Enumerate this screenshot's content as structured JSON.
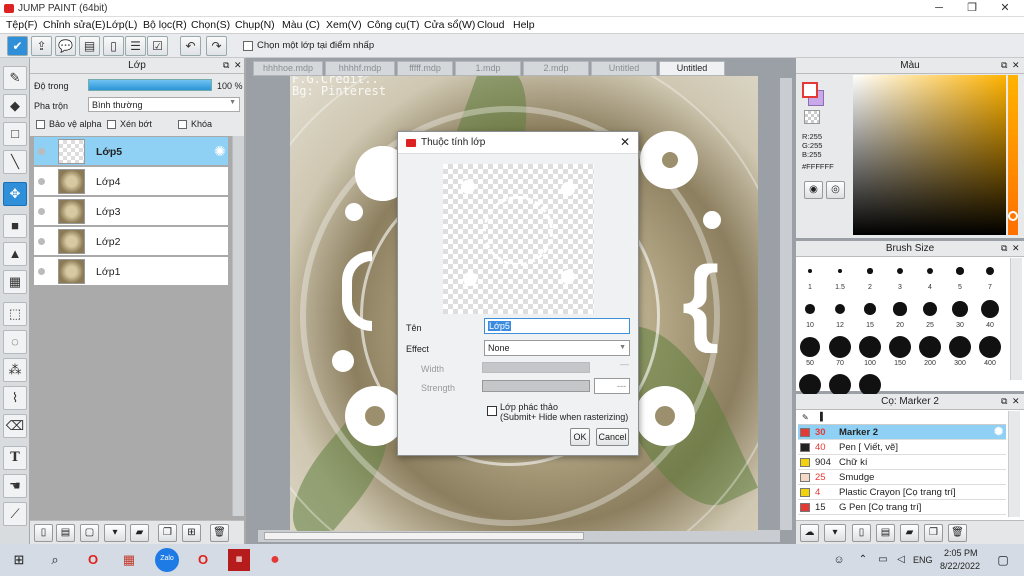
{
  "window": {
    "title": "JUMP PAINT (64bit)",
    "min": "─",
    "max": "❐",
    "close": "✕"
  },
  "menu": [
    "Tệp(F)",
    "Chỉnh sửa(E)",
    "Lớp(L)",
    "Bộ lọc(R)",
    "Chọn(S)",
    "Chụp(N)",
    "Màu (C)",
    "Xem(V)",
    "Công cụ(T)",
    "Cửa sổ(W)",
    "Cloud",
    "Help"
  ],
  "toolbar": {
    "icons": [
      "check-icon",
      "export-icon",
      "speech-bubble-icon",
      "comment-icon",
      "page-icon",
      "list-icon",
      "checklist-icon",
      "undo-icon",
      "redo-icon"
    ],
    "checkbox_label": "Chọn một lớp tại điểm nhấp"
  },
  "layer_panel": {
    "title": "Lớp",
    "opacity_label": "Độ trong",
    "opacity_value": "100 %",
    "opacity": 1.0,
    "blend_label": "Pha trộn",
    "blend_value": "Bình thường",
    "protect_alpha": "Bảo vệ alpha",
    "clip": "Xén bớt",
    "lock": "Khóa",
    "layers": [
      "Lớp5",
      "Lớp4",
      "Lớp3",
      "Lớp2",
      "Lớp1"
    ],
    "selected": "Lớp5"
  },
  "tabs": [
    "hhhhoe.mdp",
    "hhhhf.mdp",
    "fffff.mdp",
    "1.mdp",
    "2.mdp",
    "Untitled",
    "Untitled"
  ],
  "active_tab": "Untitled",
  "canvas": {
    "credit_line1": "F.G.Credit..",
    "credit_line2": "Bg: Pinterest"
  },
  "dialog": {
    "title": "Thuộc tính lớp",
    "name_label": "Tên",
    "name_value": "Lớp5",
    "effect_label": "Effect",
    "effect_value": "None",
    "width_label": "Width",
    "strength_label": "Strength",
    "strength_value": "---",
    "sketch_label": "Lớp phác thảo",
    "sketch_note": "(Submit+ Hide when rasterizing)",
    "ok": "OK",
    "cancel": "Cancel",
    "close": "✕"
  },
  "color_panel": {
    "title": "Màu",
    "r": "R:255",
    "g": "G:255",
    "b": "B:255",
    "hex": "#FFFFFF",
    "main_color": "#FFFFFF",
    "sub_color": "#C8A8E8"
  },
  "brush_panel": {
    "title": "Brush Size",
    "sizes": [
      "1",
      "1.5",
      "2",
      "3",
      "4",
      "5",
      "7",
      "10",
      "12",
      "15",
      "20",
      "25",
      "30",
      "40",
      "50",
      "70",
      "100",
      "150",
      "200",
      "300",
      "400",
      "",
      "",
      ""
    ]
  },
  "subtool_panel": {
    "title": "Cọ: Marker 2",
    "items": [
      {
        "num": "30",
        "name": "Marker 2",
        "color": "#e53935"
      },
      {
        "num": "40",
        "name": "Pen [ Viết, vẽ]",
        "color": "#222222"
      },
      {
        "num": "904",
        "name": "Chữ kí",
        "color": "#f2d20c"
      },
      {
        "num": "25",
        "name": "Smudge",
        "color": "#f3d9c6"
      },
      {
        "num": "4",
        "name": "Plastic Crayon [Cọ trang trí]",
        "color": "#f2d20c"
      },
      {
        "num": "15",
        "name": "G Pen [Cọ trang trí]",
        "color": "#e53935"
      }
    ],
    "selected": "Marker 2"
  },
  "taskbar": {
    "time": "2:05 PM",
    "date": "8/22/2022",
    "lang": "ENG"
  }
}
